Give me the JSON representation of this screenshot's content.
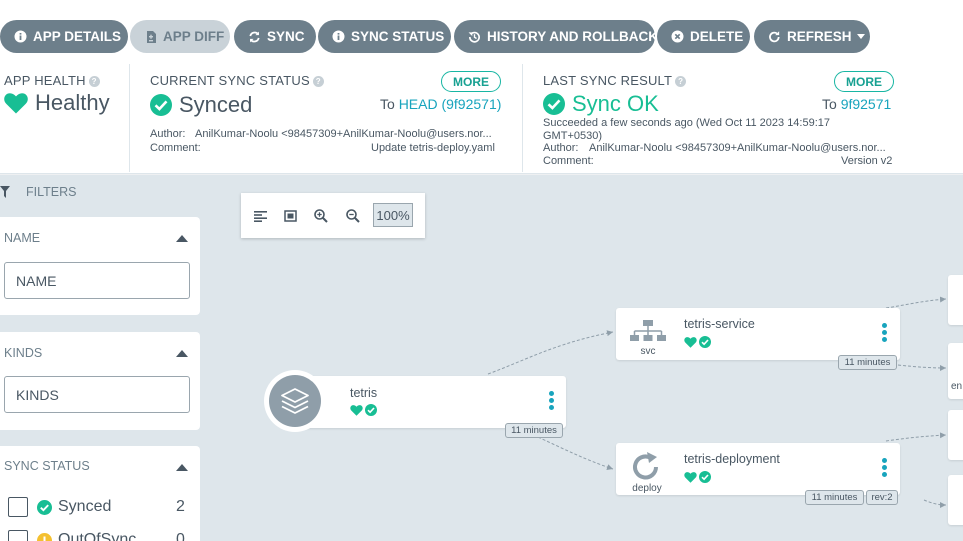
{
  "toolbar": {
    "app_details": "APP DETAILS",
    "app_diff": "APP DIFF",
    "sync": "SYNC",
    "sync_status": "SYNC STATUS",
    "history": "HISTORY AND ROLLBACK",
    "delete": "DELETE",
    "refresh": "REFRESH"
  },
  "health": {
    "label": "APP HEALTH",
    "value": "Healthy"
  },
  "current_sync": {
    "label": "CURRENT SYNC STATUS",
    "value": "Synced",
    "more": "MORE",
    "to_prefix": "To",
    "to_ref": "HEAD (9f92571)",
    "author_label": "Author:",
    "author": "AnilKumar-Noolu <98457309+AnilKumar-Noolu@users.nor...",
    "comment_label": "Comment:",
    "comment": "Update tetris-deploy.yaml"
  },
  "last_sync": {
    "label": "LAST SYNC RESULT",
    "value": "Sync OK",
    "more": "MORE",
    "to_prefix": "To",
    "to_ref": "9f92571",
    "succeeded_line1": "Succeeded a few seconds ago (Wed Oct 11 2023 14:59:17",
    "succeeded_line2": "GMT+0530)",
    "author_label": "Author:",
    "author": "AnilKumar-Noolu <98457309+AnilKumar-Noolu@users.nor...",
    "comment_label": "Comment:",
    "comment": "Version v2"
  },
  "filters": {
    "title": "FILTERS",
    "name": {
      "title": "NAME",
      "placeholder": "NAME"
    },
    "kinds": {
      "title": "KINDS",
      "placeholder": "KINDS"
    },
    "sync_status": {
      "title": "SYNC STATUS",
      "items": [
        {
          "label": "Synced",
          "count": "2"
        },
        {
          "label": "OutOfSync",
          "count": "0"
        }
      ]
    }
  },
  "graph": {
    "zoom": "100%",
    "app_node": {
      "name": "tetris",
      "age": "11 minutes"
    },
    "service_node": {
      "name": "tetris-service",
      "kind": "svc",
      "age": "11 minutes"
    },
    "deploy_node": {
      "name": "tetris-deployment",
      "kind": "deploy",
      "age": "11 minutes",
      "rev": "rev:2"
    },
    "edge_label": "en"
  },
  "colors": {
    "accent": "#18be94",
    "link": "#18a4bd",
    "button": "#6d7f8b",
    "warning": "#f4c030"
  }
}
